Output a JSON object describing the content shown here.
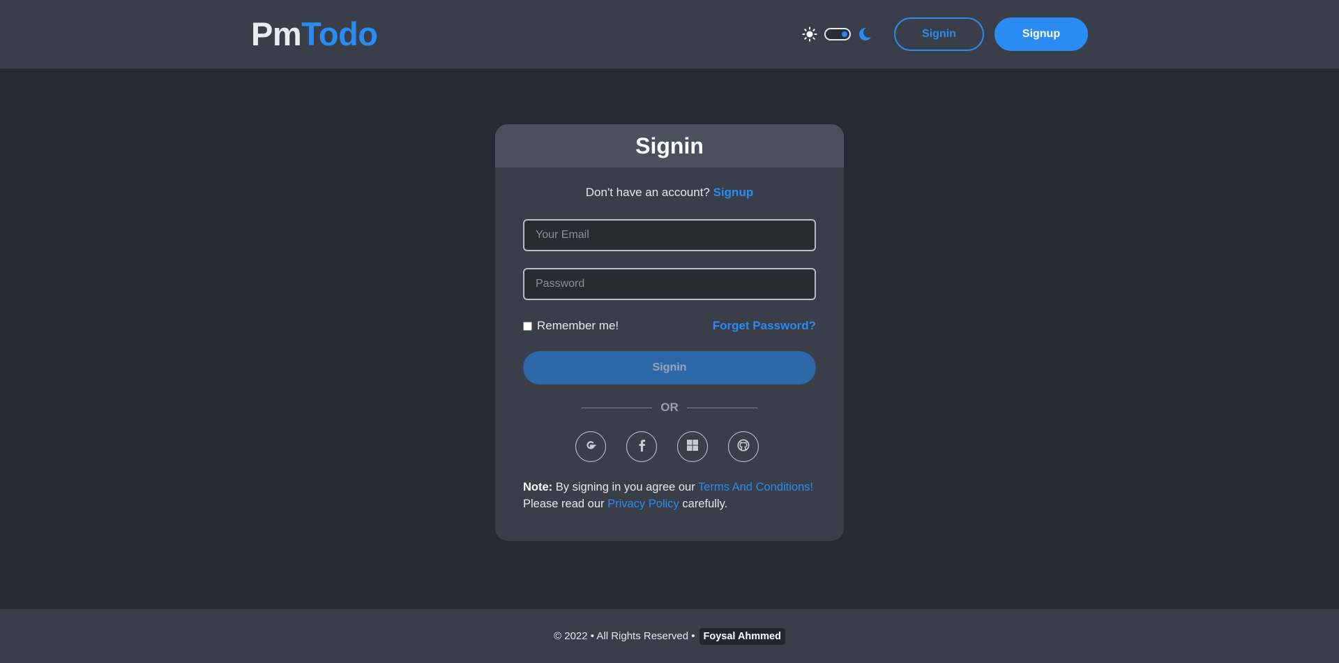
{
  "header": {
    "logo_pm": "Pm",
    "logo_todo": "Todo",
    "signin_label": "Signin",
    "signup_label": "Signup"
  },
  "card": {
    "title": "Signin",
    "no_account_text": "Don't have an account?",
    "signup_link": "Signup",
    "email_placeholder": "Your Email",
    "password_placeholder": "Password",
    "remember_label": "Remember me!",
    "forgot_label": "Forget Password?",
    "submit_label": "Signin",
    "or_label": "OR",
    "socials": [
      "google-icon",
      "facebook-icon",
      "microsoft-icon",
      "github-icon"
    ],
    "note_label": "Note:",
    "note_text_1": "By signing in you agree our",
    "terms_link": "Terms And Conditions!",
    "note_text_2": "Please read our",
    "privacy_link": "Privacy Policy",
    "note_text_3": "carefully."
  },
  "footer": {
    "copyright": "© 2022 • All Rights Reserved •",
    "author": "Foysal Ahmmed"
  },
  "colors": {
    "accent": "#2a8cf2",
    "background": "#272a32",
    "surface": "#393e48"
  }
}
